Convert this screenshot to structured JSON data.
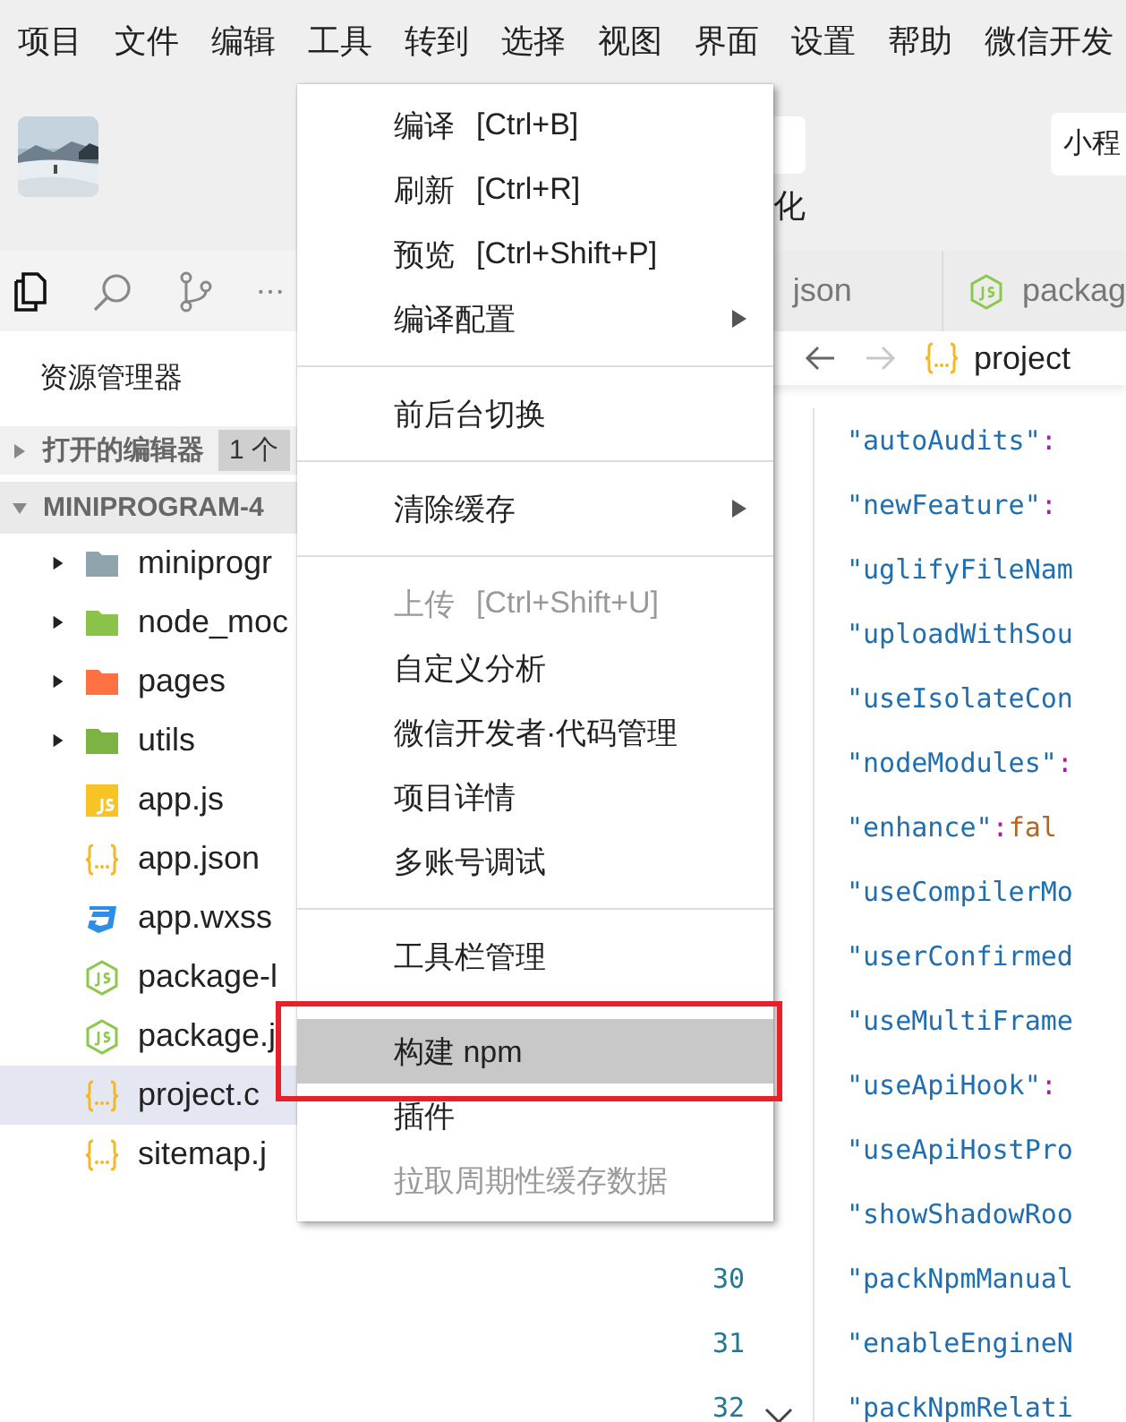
{
  "menubar": [
    "项目",
    "文件",
    "编辑",
    "工具",
    "转到",
    "选择",
    "视图",
    "界面",
    "设置",
    "帮助",
    "微信开发"
  ],
  "header": {
    "caption": "化",
    "button": "小程"
  },
  "activity_bar": [
    {
      "kind": "files",
      "selected": true
    },
    {
      "kind": "search",
      "selected": false
    },
    {
      "kind": "branch",
      "selected": false
    },
    {
      "kind": "more",
      "selected": false
    }
  ],
  "sidebar": {
    "title": "资源管理器",
    "open_editors": {
      "label": "打开的编辑器",
      "badge": "1 个",
      "expanded": false
    },
    "project": {
      "label": "MINIPROGRAM-4",
      "expanded": true
    },
    "items": [
      {
        "label": "miniprogr",
        "kind": "folder",
        "color": "#90a4ae",
        "expanded": false,
        "selected": false
      },
      {
        "label": "node_moc",
        "kind": "folder",
        "color": "#8bc34a",
        "expanded": false,
        "selected": false
      },
      {
        "label": "pages",
        "kind": "folder",
        "color": "#ff7043",
        "expanded": false,
        "selected": false
      },
      {
        "label": "utils",
        "kind": "folder",
        "color": "#7cb342",
        "expanded": false,
        "selected": false
      },
      {
        "label": "app.js",
        "kind": "js",
        "selected": false
      },
      {
        "label": "app.json",
        "kind": "json",
        "selected": false
      },
      {
        "label": "app.wxss",
        "kind": "css",
        "selected": false
      },
      {
        "label": "package-l",
        "kind": "node",
        "selected": false
      },
      {
        "label": "package.j",
        "kind": "node",
        "selected": false
      },
      {
        "label": "project.c",
        "kind": "json",
        "selected": true
      },
      {
        "label": "sitemap.j",
        "kind": "json",
        "selected": false
      }
    ]
  },
  "tabs": [
    {
      "label": "json",
      "kind": "plain",
      "selected": false
    },
    {
      "label": "packag",
      "kind": "node",
      "selected": false
    }
  ],
  "breadcrumb": {
    "label": "project"
  },
  "editor": {
    "lines": [
      {
        "key": "\"autoAudits\"",
        "punct": ":"
      },
      {
        "key": "\"newFeature\"",
        "punct": ":"
      },
      {
        "key": "\"uglifyFileNam"
      },
      {
        "key": "\"uploadWithSou"
      },
      {
        "key": "\"useIsolateCon"
      },
      {
        "key": "\"nodeModules\"",
        "punct": ":"
      },
      {
        "key": "\"enhance\"",
        "punct": ":",
        "value": "fal"
      },
      {
        "key": "\"useCompilerMo"
      },
      {
        "key": "\"userConfirmed"
      },
      {
        "key": "\"useMultiFrame"
      },
      {
        "key": "\"useApiHook\"",
        "punct": ":"
      },
      {
        "key": "\"useApiHostPro"
      },
      {
        "key": "\"showShadowRoo"
      },
      {
        "key": "\"packNpmManual",
        "number": "30"
      },
      {
        "key": "\"enableEngineN",
        "number": "31"
      },
      {
        "key": "\"packNpmRelati",
        "number": "32"
      }
    ]
  },
  "context_menu": [
    {
      "kind": "item",
      "label": "编译",
      "shortcut": "[Ctrl+B]",
      "disabled": false,
      "selected": false,
      "outlined": false
    },
    {
      "kind": "item",
      "label": "刷新",
      "shortcut": "[Ctrl+R]",
      "disabled": false,
      "selected": false,
      "outlined": false
    },
    {
      "kind": "item",
      "label": "预览",
      "shortcut": "[Ctrl+Shift+P]",
      "disabled": false,
      "selected": false,
      "outlined": false
    },
    {
      "kind": "submenu",
      "label": "编译配置",
      "disabled": false,
      "selected": false,
      "outlined": false
    },
    {
      "kind": "separator"
    },
    {
      "kind": "item",
      "label": "前后台切换",
      "disabled": false,
      "selected": false,
      "outlined": false
    },
    {
      "kind": "separator"
    },
    {
      "kind": "submenu",
      "label": "清除缓存",
      "disabled": false,
      "selected": false,
      "outlined": false
    },
    {
      "kind": "separator"
    },
    {
      "kind": "item",
      "label": "上传",
      "shortcut": "[Ctrl+Shift+U]",
      "disabled": true,
      "selected": false,
      "outlined": false
    },
    {
      "kind": "item",
      "label": "自定义分析",
      "disabled": false,
      "selected": false,
      "outlined": false
    },
    {
      "kind": "item",
      "label": "微信开发者·代码管理",
      "disabled": false,
      "selected": false,
      "outlined": false
    },
    {
      "kind": "item",
      "label": "项目详情",
      "disabled": false,
      "selected": false,
      "outlined": false
    },
    {
      "kind": "item",
      "label": "多账号调试",
      "disabled": false,
      "selected": false,
      "outlined": false
    },
    {
      "kind": "separator"
    },
    {
      "kind": "item",
      "label": "工具栏管理",
      "disabled": false,
      "selected": false,
      "outlined": false
    },
    {
      "kind": "separator"
    },
    {
      "kind": "item",
      "label": "构建 npm",
      "disabled": false,
      "selected": true,
      "outlined": true
    },
    {
      "kind": "item",
      "label": "插件",
      "disabled": false,
      "selected": false,
      "outlined": false
    },
    {
      "kind": "item",
      "label": "拉取周期性缓存数据",
      "disabled": true,
      "selected": false,
      "outlined": false
    }
  ]
}
